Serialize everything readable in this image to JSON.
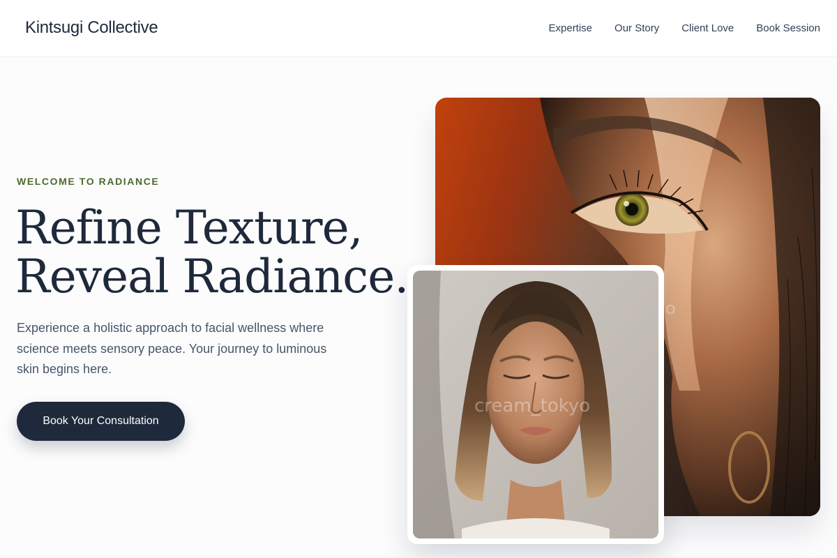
{
  "header": {
    "brand": "Kintsugi Collective",
    "nav": [
      {
        "label": "Expertise"
      },
      {
        "label": "Our Story"
      },
      {
        "label": "Client Love"
      },
      {
        "label": "Book Session"
      }
    ]
  },
  "hero": {
    "eyebrow": "WELCOME TO RADIANCE",
    "headline_line1": "Refine Texture,",
    "headline_line2": "Reveal Radiance.",
    "description": "Experience a holistic approach to facial wellness where science meets sensory peace. Your journey to luminous skin begins here.",
    "cta_label": "Book Your Consultation"
  },
  "images": {
    "large": {
      "subject": "close-up of woman's eye in warm sunlight"
    },
    "small": {
      "subject": "woman with wet hair and eyes closed",
      "watermark": "cream_tokyo"
    }
  },
  "colors": {
    "brand_navy": "#1e293b",
    "eyebrow_green": "#4d6a2e",
    "text_muted": "#475569",
    "background": "#fcfcfd"
  }
}
